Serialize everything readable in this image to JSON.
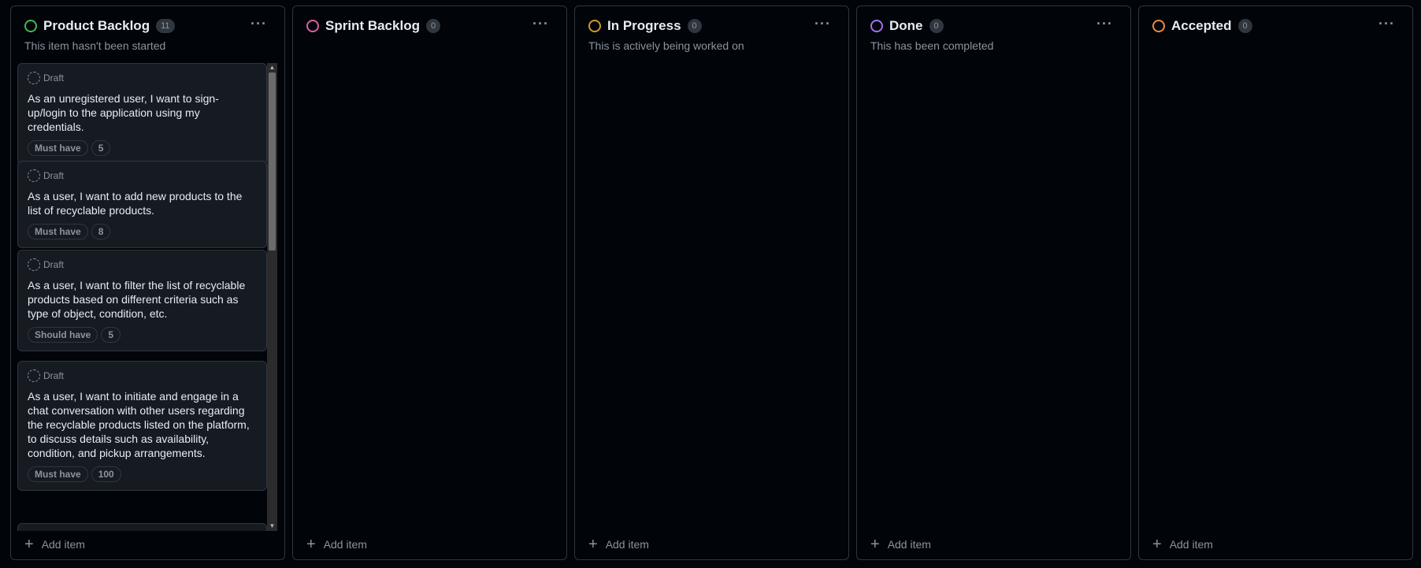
{
  "columns": [
    {
      "title": "Product Backlog",
      "count": "11",
      "color": "#3fb950",
      "description": "This item hasn't been started",
      "add_label": "Add item",
      "cards": [
        {
          "status": "Draft",
          "title": "As an unregistered user, I want to sign-up/login to the application using my credentials.",
          "priority": "Must have",
          "points": "5"
        },
        {
          "status": "Draft",
          "title": "As a user, I want to add new products to the list of recyclable products.",
          "priority": "Must have",
          "points": "8"
        },
        {
          "status": "Draft",
          "title": "As a user, I want to filter the list of recyclable products based on different criteria such as type of object, condition, etc.",
          "priority": "Should have",
          "points": "5"
        },
        {
          "status": "Draft",
          "title": "As a user, I want to initiate and engage in a chat conversation with other users regarding the recyclable products listed on the platform, to discuss details such as availability, condition, and pickup arrangements.",
          "priority": "Must have",
          "points": "100"
        }
      ]
    },
    {
      "title": "Sprint Backlog",
      "count": "0",
      "color": "#db61a2",
      "description": "",
      "add_label": "Add item"
    },
    {
      "title": "In Progress",
      "count": "0",
      "color": "#d29922",
      "description": "This is actively being worked on",
      "add_label": "Add item"
    },
    {
      "title": "Done",
      "count": "0",
      "color": "#a371f7",
      "description": "This has been completed",
      "add_label": "Add item"
    },
    {
      "title": "Accepted",
      "count": "0",
      "color": "#f0883e",
      "description": "",
      "add_label": "Add item"
    }
  ],
  "icons": {
    "more": "more-horizontal-icon",
    "plus": "plus-icon",
    "draft": "draft-circle-icon",
    "scroll_up": "chevron-up-icon",
    "scroll_down": "chevron-down-icon"
  }
}
